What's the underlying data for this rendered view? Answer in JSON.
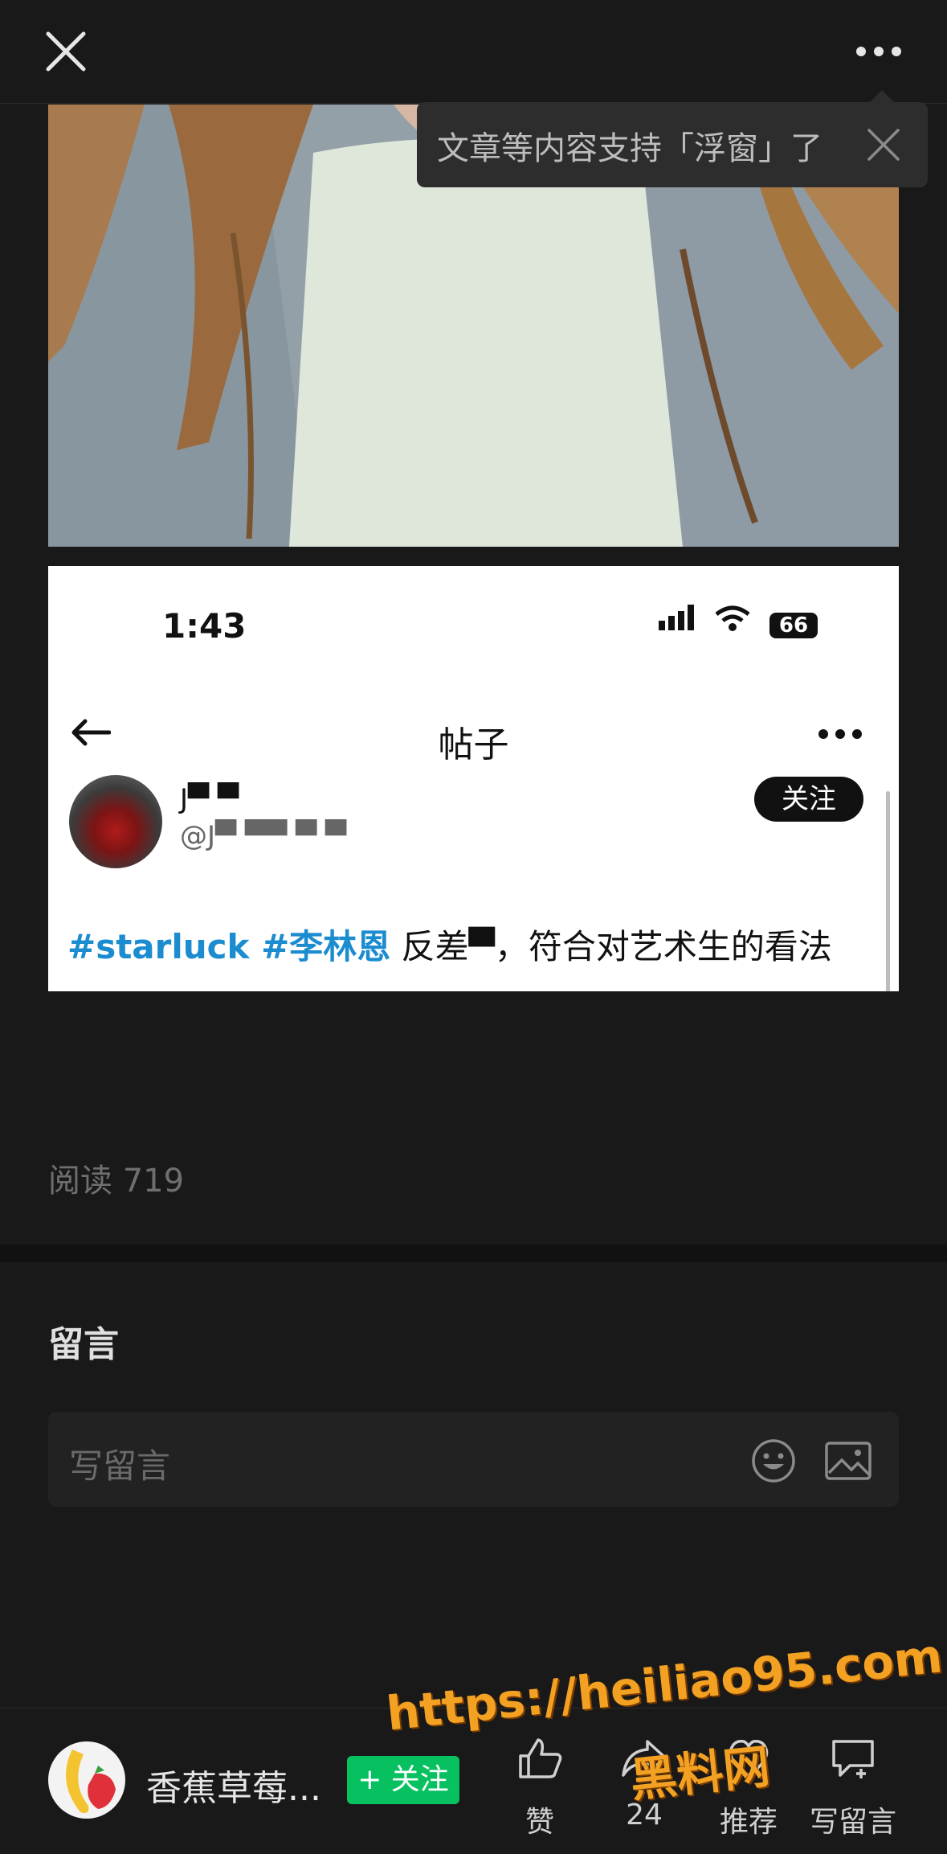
{
  "tooltip": {
    "text": "文章等内容支持「浮窗」了"
  },
  "embedded": {
    "status_time": "1:43",
    "battery": "66",
    "title": "帖子",
    "follow_label": "关注",
    "name_masked": "J▀ ▀",
    "handle_masked": "@J▀ ▀▀  ▀ ▀",
    "caption_tags": "#starluck #李林恩",
    "caption_text": " 反差▀，符合对艺术生的看法"
  },
  "article": {
    "read_count": "阅读 719"
  },
  "comments": {
    "title": "留言",
    "placeholder": "写留言"
  },
  "author": {
    "name": "香蕉草莓...",
    "follow_label": "+ 关注"
  },
  "actions": [
    {
      "label": "赞",
      "icon": "like-icon"
    },
    {
      "label": "24",
      "icon": "share-icon"
    },
    {
      "label": "推荐",
      "icon": "recommend-icon"
    },
    {
      "label": "写留言",
      "icon": "write-comment-icon"
    }
  ],
  "watermark": {
    "url": "https://heiliao95.com",
    "cn": "黑料网"
  },
  "colors": {
    "bg": "#191919",
    "follow_green": "#07c160",
    "tag_blue": "#1a8ccf",
    "watermark": "#f2a122"
  }
}
